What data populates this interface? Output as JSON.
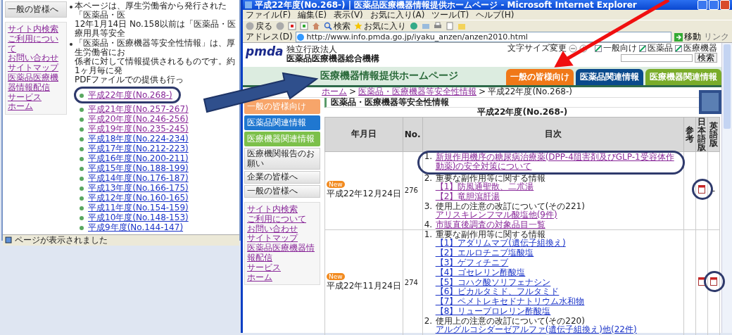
{
  "back_window": {
    "sidebar_button": "一般の皆様へ",
    "sidebar_links": [
      "サイト内検索",
      "ご利用について",
      "お問い合わせ",
      "サイトマップ",
      "医薬品医療機器情報配信",
      "サービス",
      "ホーム"
    ],
    "notes": [
      [
        "本ページは、厚生労働省から発行された「医薬品・医",
        "12年1月14日 No.158以前は「医薬品・医療用具等安全"
      ],
      [
        "「医薬品・医療機器等安全性情報」は、厚生労働省にお",
        "係者に対して情報提供されるものです。約1ヶ月毎に発",
        "PDFファイルでの提供も行っ"
      ]
    ],
    "years": [
      {
        "label": "平成22年度(No.268-)",
        "visited": true
      },
      {
        "label": "平成21年度(No.257-267)",
        "visited": true
      },
      {
        "label": "平成20年度(No.246-256)",
        "visited": true
      },
      {
        "label": "平成19年度(No.235-245)",
        "visited": true
      },
      {
        "label": "平成18年度(No.224-234)",
        "visited": false
      },
      {
        "label": "平成17年度(No.212-223)",
        "visited": false
      },
      {
        "label": "平成16年度(No.200-211)",
        "visited": false
      },
      {
        "label": "平成15年度(No.188-199)",
        "visited": false
      },
      {
        "label": "平成14年度(No.176-187)",
        "visited": false
      },
      {
        "label": "平成13年度(No.166-175)",
        "visited": false
      },
      {
        "label": "平成12年度(No.160-165)",
        "visited": false
      },
      {
        "label": "平成11年度(No.154-159)",
        "visited": false
      },
      {
        "label": "平成10年度(No.148-153)",
        "visited": false
      },
      {
        "label": "平成9年度(No.144-147)",
        "visited": false
      }
    ],
    "status": "ページが表示されました"
  },
  "browser": {
    "title": "平成22年度(No.268-) | 医薬品医療機器情報提供ホームページ - Microsoft Internet Explorer",
    "menu": [
      "ファイル(F)",
      "編集(E)",
      "表示(V)",
      "お気に入り(A)",
      "ツール(T)",
      "ヘルプ(H)"
    ],
    "toolbar": {
      "back": "戻る",
      "search": "検索",
      "favorites": "お気に入り"
    },
    "address": {
      "label": "アドレス(D)",
      "url": "http://www.info.pmda.go.jp/iyaku_anzen/anzen2010.html",
      "go": "移動",
      "links": "リンク"
    }
  },
  "site": {
    "logo": "pmda",
    "org_type": "独立行政法人",
    "org_name": "医薬品医療機器総合機構",
    "font_size_label": "文字サイズ変更",
    "filters": [
      {
        "label": "一般向け",
        "checked": true
      },
      {
        "label": "医薬品",
        "checked": true
      },
      {
        "label": "医療機器",
        "checked": true
      }
    ],
    "search_button": "検索",
    "banner": "医療機器情報提供ホームページ",
    "tabs": [
      {
        "label": "一般の皆様向け",
        "color": "#f07818"
      },
      {
        "label": "医薬品関連情報",
        "color": "#0a4a8c"
      },
      {
        "label": "医療機器関連情報",
        "color": "#7aac2a"
      }
    ],
    "breadcrumb": [
      "ホーム",
      "医薬品・医療機器等安全性情報",
      "平成22年度(No.268-)"
    ],
    "breadcrumb_separator": ">",
    "nav_buttons": [
      {
        "label": "一般の皆様向け",
        "color": "#f7a56a"
      },
      {
        "label": "医薬品関連情報",
        "color": "#1f77d0"
      },
      {
        "label": "医療機器関連情報",
        "color": "#7cc04a"
      }
    ],
    "nav_items": [
      "医療機関報告のお願い",
      "企業の皆様へ",
      "一般の皆様へ"
    ],
    "nav_links": [
      "サイト内検索",
      "ご利用について",
      "お問い合わせ",
      "サイトマップ",
      "医薬品医療機器情報配信",
      "サービス",
      "ホーム"
    ],
    "heading": "医薬品・医療機器等安全性情報",
    "caption": "平成22年度(No.268-)",
    "columns": [
      "年月日",
      "No.",
      "目次",
      "参考",
      "日本語版",
      "英語版"
    ],
    "rows": [
      {
        "badge": "New",
        "date": "平成22年12月24日",
        "no": "276",
        "visited": true,
        "ja_pdf": true,
        "en_pdf": false,
        "en_text": "-",
        "items": [
          {
            "num": "1.",
            "text": "新規作用機序の糖尿病治療薬(DPP-4阻害剤及びGLP-1受容体作動薬)の安全対策について",
            "linked": true
          },
          {
            "num": "2.",
            "text": "重要な副作用等に関する情報",
            "linked": false,
            "links": [
              "【1】防風通聖散、二朮湯",
              "【2】竜胆瀉肝湯"
            ]
          },
          {
            "num": "3.",
            "text": "使用上の注意の改訂について(その221)",
            "linked": false,
            "links": [
              "アリスキレンフマル酸塩他(9件)"
            ]
          },
          {
            "num": "4.",
            "text": "市販直後調査の対象品目一覧",
            "linked": true
          }
        ]
      },
      {
        "badge": "New",
        "date": "平成22年11月24日",
        "no": "274",
        "visited": false,
        "ja_pdf": true,
        "en_pdf": true,
        "items": [
          {
            "num": "1.",
            "text": "重要な副作用等に関する情報",
            "linked": false,
            "links": [
              "【1】アダリムマブ(遺伝子組換え)",
              "【2】エルロチニブ塩酸塩",
              "【3】ゲフィチニブ",
              "【4】ゴセレリン酢酸塩",
              "【5】コハク酸ソリフェナシン",
              "【6】ビカルタミド、フルタミド",
              "【7】ペメトレキセドナトリウム水和物",
              "【8】リュープロレリン酢酸塩"
            ]
          },
          {
            "num": "2.",
            "text": "使用上の注意の改訂について(その220)",
            "linked": false,
            "links": [
              "アルグルコシダーゼアルファ(遺伝子組換え)他(22件)"
            ]
          }
        ]
      }
    ]
  }
}
